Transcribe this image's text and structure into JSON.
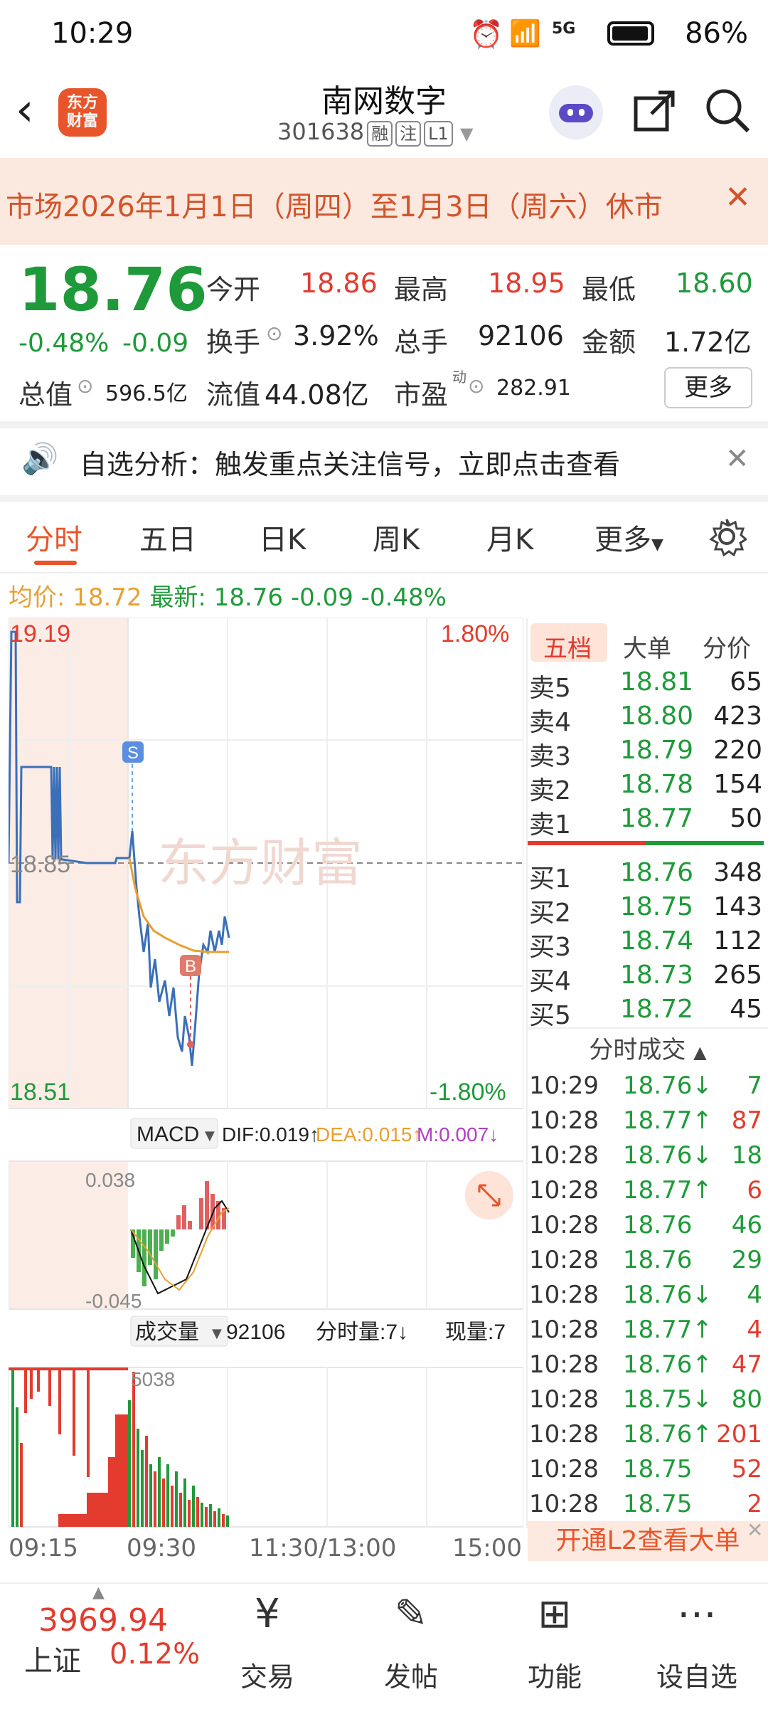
{
  "status_bar": {
    "time": "10:29",
    "network": "5G",
    "battery": "86%"
  },
  "header": {
    "logo_text": "东方\n财富",
    "title": "南网数字",
    "code": "301638",
    "tags": [
      "融",
      "注",
      "L1"
    ]
  },
  "notice": {
    "text": "市场2026年1月1日（周四）至1月3日（周六）休市"
  },
  "quote": {
    "price": "18.76",
    "change_pct": "-0.48%",
    "change": "-0.09",
    "open_label": "今开",
    "open": "18.86",
    "high_label": "最高",
    "high": "18.95",
    "low_label": "最低",
    "low": "18.60",
    "turnover_label": "换手",
    "turnover": "3.92%",
    "volume_label": "总手",
    "volume": "92106",
    "amount_label": "金额",
    "amount": "1.72亿",
    "mktcap_label": "总值",
    "mktcap": "596.5亿",
    "float_label": "流值",
    "float": "44.08亿",
    "pe_label": "市盈",
    "pe_sup": "动",
    "pe": "282.91",
    "more": "更多"
  },
  "analysis": {
    "text": "自选分析：触发重点关注信号，立即点击查看"
  },
  "tabs": [
    "分时",
    "五日",
    "日K",
    "周K",
    "月K",
    "更多"
  ],
  "avg_row": {
    "avg_label": "均价:",
    "avg": "18.72",
    "latest_label": "最新:",
    "latest": "18.76",
    "chg": "-0.09",
    "pct": "-0.48%"
  },
  "chart": {
    "top_price": "19.19",
    "mid_price": "18.85",
    "bottom_price": "18.51",
    "top_pct": "1.80%",
    "bottom_pct": "-1.80%",
    "watermark": "东方财富",
    "marker_s": "S",
    "marker_b": "B",
    "macd": {
      "label": "MACD",
      "dif": "DIF:0.019↑",
      "dea": "DEA:0.015↑",
      "m": "M:0.007↓",
      "top": "0.038",
      "bottom": "-0.045"
    },
    "vol": {
      "label": "成交量",
      "total": "92106",
      "per_min": "分时量:7↓",
      "now": "现量:7",
      "top": "5038"
    },
    "time_axis": [
      "09:15",
      "09:30",
      "11:30/13:00",
      "15:00"
    ]
  },
  "orderbook": {
    "tabs": [
      "五档",
      "大单",
      "分价"
    ],
    "asks": [
      {
        "label": "卖5",
        "price": "18.81",
        "vol": "65"
      },
      {
        "label": "卖4",
        "price": "18.80",
        "vol": "423"
      },
      {
        "label": "卖3",
        "price": "18.79",
        "vol": "220"
      },
      {
        "label": "卖2",
        "price": "18.78",
        "vol": "154"
      },
      {
        "label": "卖1",
        "price": "18.77",
        "vol": "50"
      }
    ],
    "bids": [
      {
        "label": "买1",
        "price": "18.76",
        "vol": "348"
      },
      {
        "label": "买2",
        "price": "18.75",
        "vol": "143"
      },
      {
        "label": "买3",
        "price": "18.74",
        "vol": "112"
      },
      {
        "label": "买4",
        "price": "18.73",
        "vol": "265"
      },
      {
        "label": "买5",
        "price": "18.72",
        "vol": "45"
      }
    ]
  },
  "trades": {
    "header": "分时成交",
    "rows": [
      {
        "time": "10:29",
        "price": "18.76↓",
        "vol": "7",
        "dir": "down"
      },
      {
        "time": "10:28",
        "price": "18.77↑",
        "vol": "87",
        "dir": "up"
      },
      {
        "time": "10:28",
        "price": "18.76↓",
        "vol": "18",
        "dir": "down"
      },
      {
        "time": "10:28",
        "price": "18.77↑",
        "vol": "6",
        "dir": "up"
      },
      {
        "time": "10:28",
        "price": "18.76",
        "vol": "46",
        "dir": "none"
      },
      {
        "time": "10:28",
        "price": "18.76",
        "vol": "29",
        "dir": "none"
      },
      {
        "time": "10:28",
        "price": "18.76↓",
        "vol": "4",
        "dir": "down"
      },
      {
        "time": "10:28",
        "price": "18.77↑",
        "vol": "4",
        "dir": "up"
      },
      {
        "time": "10:28",
        "price": "18.76↑",
        "vol": "47",
        "dir": "up"
      },
      {
        "time": "10:28",
        "price": "18.75↓",
        "vol": "80",
        "dir": "down"
      },
      {
        "time": "10:28",
        "price": "18.76↑",
        "vol": "201",
        "dir": "up"
      },
      {
        "time": "10:28",
        "price": "18.75",
        "vol": "52",
        "dir": "red"
      },
      {
        "time": "10:28",
        "price": "18.75",
        "vol": "2",
        "dir": "red"
      }
    ],
    "l2_banner": "开通L2查看大单"
  },
  "bottom_nav": {
    "index_value": "3969.94",
    "index_name": "上证",
    "index_pct": "0.12%",
    "items": [
      "交易",
      "发帖",
      "功能",
      "设自选"
    ]
  }
}
